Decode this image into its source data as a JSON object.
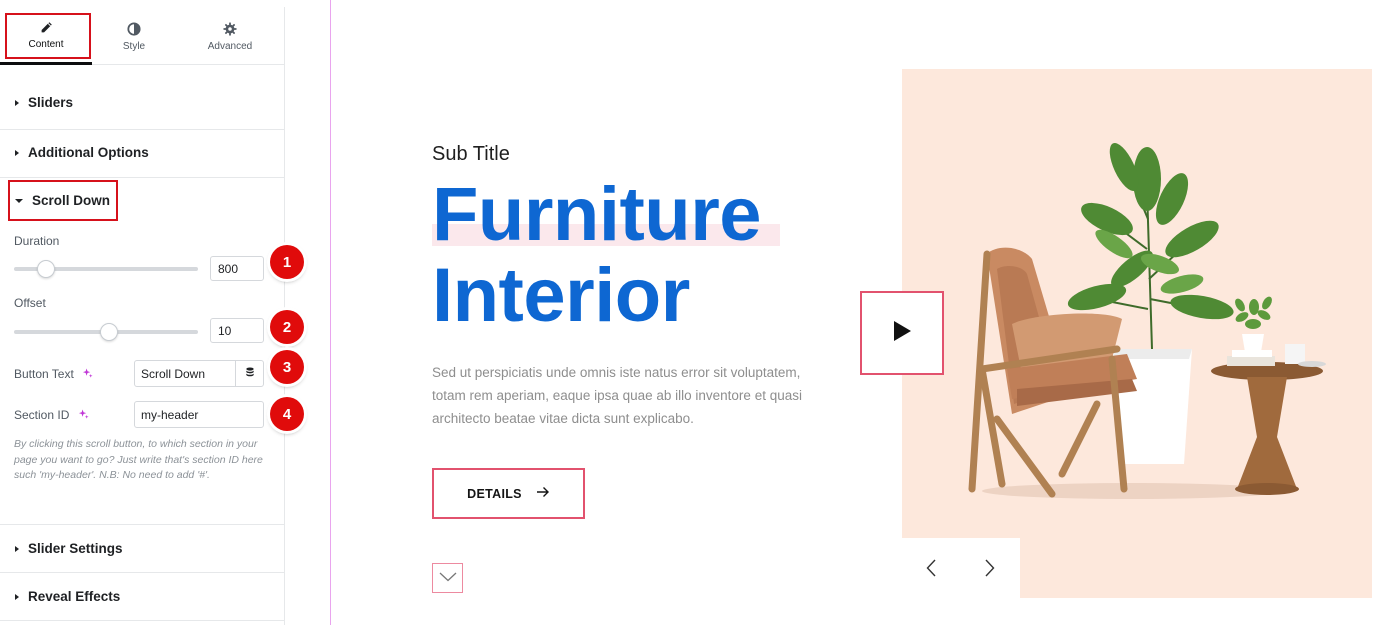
{
  "tabs": [
    {
      "label": "Content",
      "icon": "pencil-icon"
    },
    {
      "label": "Style",
      "icon": "half-circle-icon"
    },
    {
      "label": "Advanced",
      "icon": "gear-icon"
    }
  ],
  "sections": {
    "sliders": "Sliders",
    "additional": "Additional Options",
    "scroll_down": "Scroll Down",
    "slider_settings": "Slider Settings",
    "reveal_effects": "Reveal Effects"
  },
  "scroll_down": {
    "duration_label": "Duration",
    "duration_value": "800",
    "duration_level": 0.14,
    "offset_label": "Offset",
    "offset_value": "10",
    "offset_level": 0.52,
    "button_text_label": "Button Text",
    "button_text_value": "Scroll Down",
    "section_id_label": "Section ID",
    "section_id_value": "my-header",
    "help": "By clicking this scroll button, to which section in your page you want to go? Just write that's section ID here such 'my-header'. N.B: No need to add '#'."
  },
  "badges": [
    "1",
    "2",
    "3",
    "4"
  ],
  "hero": {
    "sub_title": "Sub Title",
    "title_line1": "Furniture",
    "title_line2": "Interior",
    "description": "Sed ut perspiciatis unde omnis iste natus error sit voluptatem, totam rem aperiam, eaque ipsa quae ab illo inventore et quasi architecto beatae vitae dicta sunt explicabo.",
    "button_label": "DETAILS"
  },
  "colors": {
    "accent_blue": "#0e67d2",
    "highlight_red": "#d6111b",
    "badge_red": "#e00b0b",
    "button_border": "#e2526e",
    "image_bg": "#fde8dc"
  }
}
